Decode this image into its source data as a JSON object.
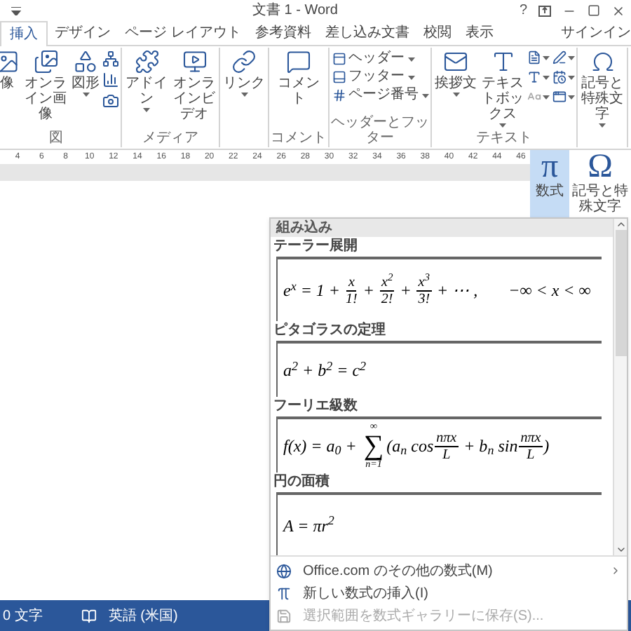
{
  "window": {
    "title": "文書 1 - Word",
    "help": "?"
  },
  "tabs": [
    {
      "label": "挿入",
      "selected": true
    },
    {
      "label": "デザイン",
      "selected": false
    },
    {
      "label": "ページ レイアウト",
      "selected": false
    },
    {
      "label": "参考資料",
      "selected": false
    },
    {
      "label": "差し込み文書",
      "selected": false
    },
    {
      "label": "校閲",
      "selected": false
    },
    {
      "label": "表示",
      "selected": false
    }
  ],
  "sign_in": "サインイン",
  "ribbon": {
    "groups": [
      {
        "label": "図",
        "items": [
          {
            "kind": "large",
            "label": "像",
            "dropdown": false
          },
          {
            "kind": "large",
            "label": "オンライン画像",
            "dropdown": false
          },
          {
            "kind": "large",
            "label": "図形",
            "dropdown": true
          },
          {
            "kind": "icons"
          }
        ]
      },
      {
        "label": "メディア",
        "items": [
          {
            "kind": "large",
            "label": "アドイン",
            "dropdown": true
          },
          {
            "kind": "large",
            "label": "オンラインビデオ",
            "dropdown": false
          }
        ]
      },
      {
        "items": [
          {
            "kind": "large",
            "label": "リンク",
            "dropdown": true
          }
        ]
      },
      {
        "label": "コメント",
        "items": [
          {
            "kind": "large",
            "label": "コメント",
            "dropdown": false
          }
        ]
      },
      {
        "label": "ヘッダーとフッター",
        "items": [
          {
            "kind": "small",
            "label": "ヘッダー",
            "dropdown": true
          },
          {
            "kind": "small",
            "label": "フッター",
            "dropdown": true
          },
          {
            "kind": "small",
            "label": "ページ番号",
            "dropdown": true
          }
        ]
      },
      {
        "label": "テキスト",
        "items": [
          {
            "kind": "large",
            "label": "挨拶文",
            "dropdown": true
          },
          {
            "kind": "large",
            "label": "テキストボックス",
            "dropdown": true
          },
          {
            "kind": "icongrid"
          }
        ]
      },
      {
        "items": [
          {
            "kind": "large",
            "label": "記号と特殊文字",
            "dropdown": true
          }
        ]
      }
    ]
  },
  "ruler": [
    "4",
    "6",
    "8",
    "10",
    "12",
    "14",
    "16",
    "18",
    "20",
    "22",
    "24",
    "26",
    "28",
    "30",
    "32",
    "34",
    "36",
    "38",
    "40",
    "42",
    "44",
    "46"
  ],
  "equation_menu": {
    "buttons": [
      {
        "label": "数式",
        "symbol": "π",
        "selected": true
      },
      {
        "label": "記号と特殊文字",
        "symbol": "Ω",
        "selected": false
      }
    ],
    "heading": "組み込み",
    "items": [
      {
        "title": "テーラー展開",
        "tokens": [
          {
            "kind": "text",
            "text": "e$^{x}$ = 1 + "
          },
          {
            "kind": "frac",
            "num": "x",
            "den": "1!"
          },
          {
            "kind": "text",
            "text": " + "
          },
          {
            "kind": "frac",
            "num": "x$^{2}$",
            "den": "2!"
          },
          {
            "kind": "text",
            "text": " + "
          },
          {
            "kind": "frac",
            "num": "x$^{3}$",
            "den": "3!"
          },
          {
            "kind": "text",
            "text": " + ⋯ ,"
          },
          {
            "kind": "far",
            "text": "−∞ < x < ∞"
          }
        ]
      },
      {
        "title": "ピタゴラスの定理",
        "tokens": [
          {
            "kind": "text",
            "text": "a$^{2}$ + b$^{2}$ = c$^{2}$"
          }
        ]
      },
      {
        "title": "フーリエ級数",
        "tokens": [
          {
            "kind": "text",
            "text": "f(x) = a$_{0}$ + "
          },
          {
            "kind": "sum",
            "top": "∞",
            "symbol": "∑",
            "bottom": "n=1"
          },
          {
            "kind": "text",
            "text": "(a$_{n}$ cos"
          },
          {
            "kind": "frac",
            "num": "nπx",
            "den": "L"
          },
          {
            "kind": "text",
            "text": " + b$_{n}$ sin"
          },
          {
            "kind": "frac",
            "num": "nπx",
            "den": "L"
          },
          {
            "kind": "text",
            "text": ")"
          }
        ]
      },
      {
        "title": "円の面積",
        "tokens": [
          {
            "kind": "text",
            "text": "A = πr$^{2}$"
          }
        ]
      }
    ],
    "commands": [
      {
        "label": "Office.com のその他の数式(M)",
        "submenu": true,
        "disabled": false
      },
      {
        "label": "新しい数式の挿入(I)",
        "submenu": false,
        "disabled": false
      },
      {
        "label": "選択範囲を数式ギャラリーに保存(S)...",
        "submenu": false,
        "disabled": true
      }
    ]
  },
  "status_bar": {
    "word_count": "0 文字",
    "language": "英語 (米国)"
  }
}
